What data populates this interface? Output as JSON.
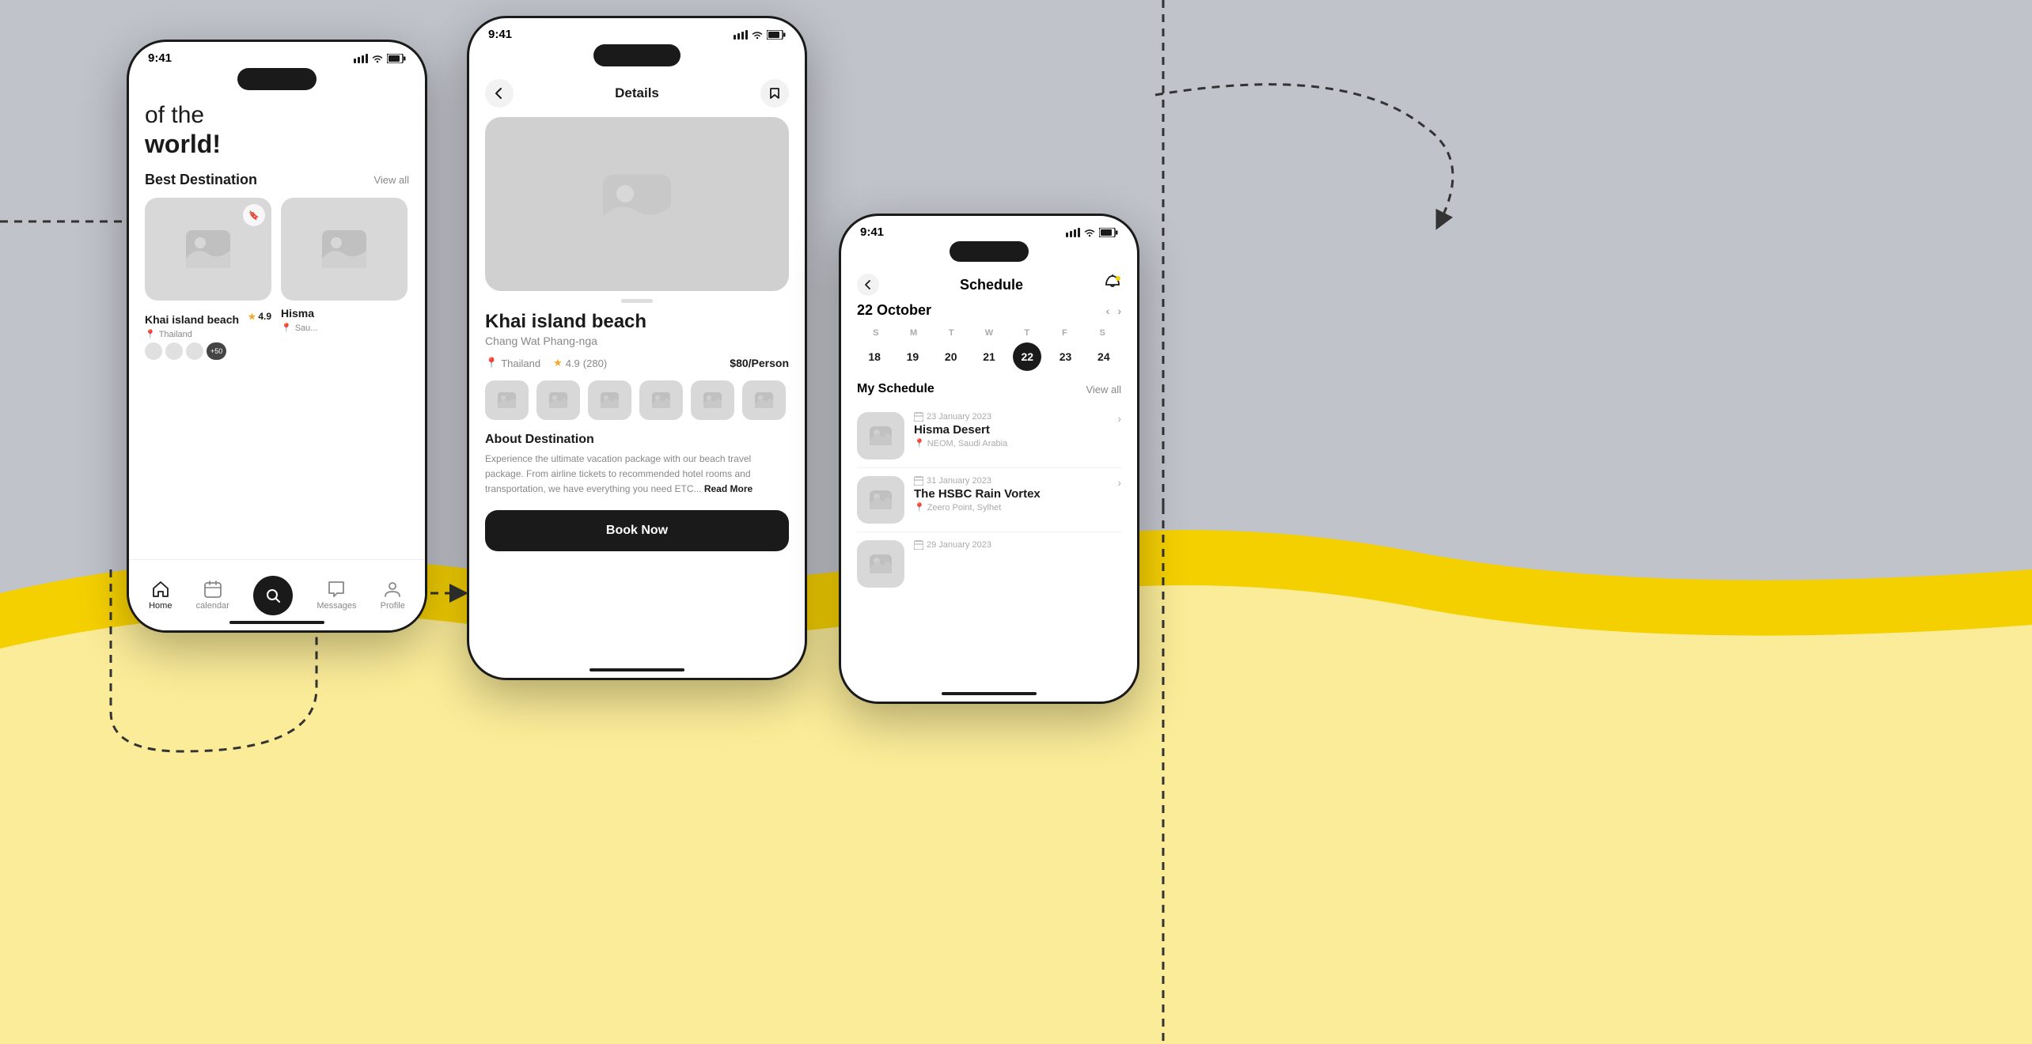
{
  "background": {
    "gray_color": "#b0b5bc",
    "yellow_color": "#f5d000"
  },
  "phone_left": {
    "status_time": "9:41",
    "section_title": "Best Destination",
    "view_all": "View all",
    "cards": [
      {
        "name": "Khai island beach",
        "location": "Thailand",
        "rating": "4.9"
      },
      {
        "name": "Hisma",
        "location": "Sau..."
      }
    ],
    "nav": {
      "home": "Home",
      "calendar": "calendar",
      "messages": "Messages",
      "profile": "Profile"
    }
  },
  "phone_center": {
    "status_time": "9:41",
    "header_title": "Details",
    "dest_name": "Khai island beach",
    "dest_sub": "Chang Wat Phang-nga",
    "location": "Thailand",
    "rating": "4.9",
    "reviews": "(280)",
    "price": "$80/Person",
    "about_title": "About Destination",
    "about_text": "Experience the ultimate vacation package with our beach travel package. From airline tickets to recommended hotel rooms and transportation, we have everything you need ETC...",
    "read_more": "Read More",
    "book_now": "Book Now"
  },
  "phone_right": {
    "status_time": "9:41",
    "schedule_title": "Schedule",
    "month": "22 October",
    "day_labels": [
      "S",
      "M",
      "T",
      "W",
      "T",
      "F",
      "S"
    ],
    "dates": [
      "18",
      "19",
      "20",
      "21",
      "22",
      "23",
      "24"
    ],
    "active_date": "22",
    "my_schedule_title": "My Schedule",
    "view_all": "View all",
    "schedule_items": [
      {
        "date": "23 January 2023",
        "name": "Hisma Desert",
        "location": "NEOM, Saudi Arabia"
      },
      {
        "date": "31 January 2023",
        "name": "The HSBC Rain Vortex",
        "location": "Zeero Point, Sylhet"
      },
      {
        "date": "29 January 2023",
        "name": "",
        "location": ""
      }
    ]
  }
}
